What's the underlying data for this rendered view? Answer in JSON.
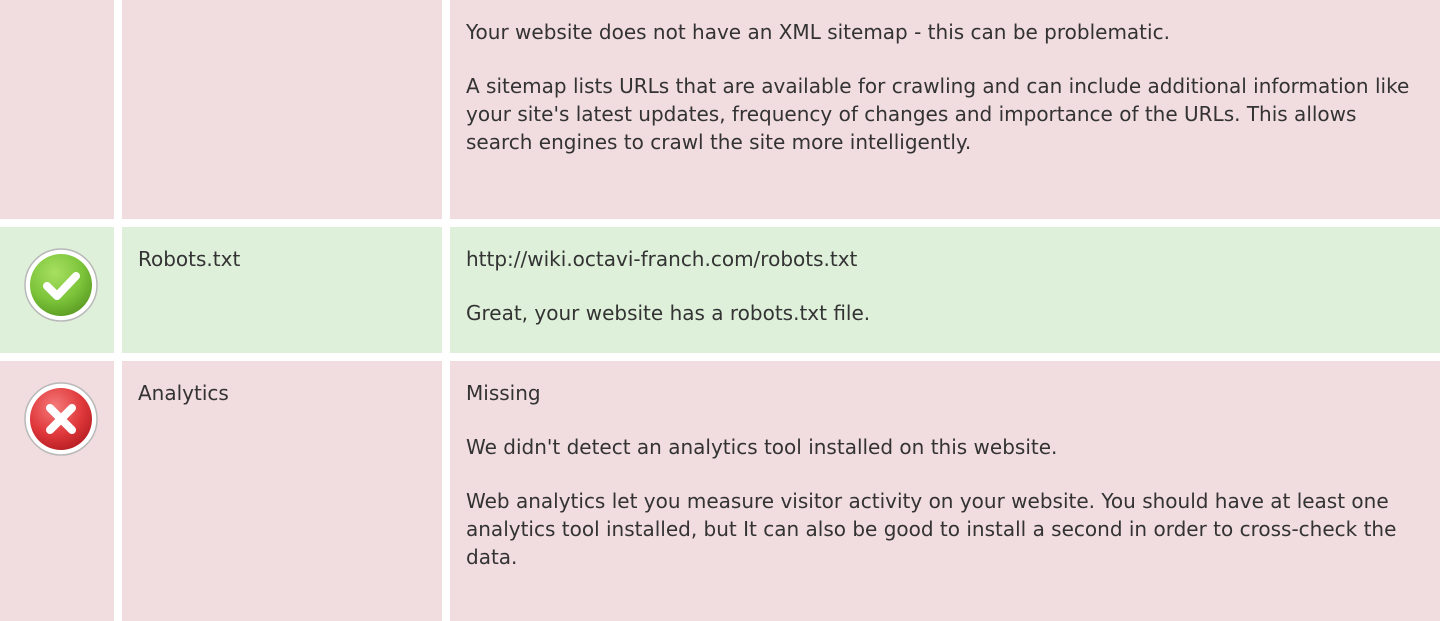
{
  "rows": [
    {
      "status": "error",
      "label": "",
      "paragraphs": [
        "Your website does not have an XML sitemap - this can be problematic.",
        "A sitemap lists URLs that are available for crawling and can include additional information like your site's latest updates, frequency of changes and importance of the URLs. This allows search engines to crawl the site more intelligently."
      ]
    },
    {
      "status": "success",
      "icon": "check-circle-icon",
      "label": "Robots.txt",
      "paragraphs": [
        "http://wiki.octavi-franch.com/robots.txt",
        "Great, your website has a robots.txt file."
      ]
    },
    {
      "status": "error",
      "icon": "error-x-circle-icon",
      "label": "Analytics",
      "paragraphs": [
        "Missing",
        "We didn't detect an analytics tool installed on this website.",
        "Web analytics let you measure visitor activity on your website. You should have at least one analytics tool installed, but It can also be good to install a second in order to cross-check the data."
      ]
    }
  ],
  "colors": {
    "error_bg": "#f1dcdf",
    "success_bg": "#def0da",
    "text": "#333333",
    "check_green": "#7cc43a",
    "error_red": "#e0383b"
  }
}
